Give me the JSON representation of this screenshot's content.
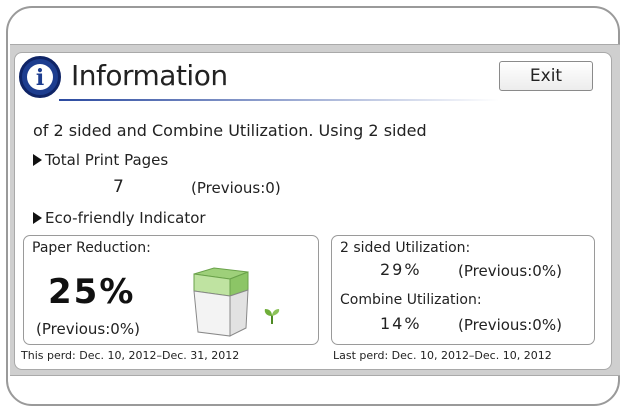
{
  "header": {
    "title": "Information",
    "exit_label": "Exit"
  },
  "description": "of 2 sided and Combine Utilization. Using 2 sided",
  "total_print_pages": {
    "heading": "Total Print Pages",
    "value": "7",
    "previous": "(Previous:0)"
  },
  "eco": {
    "heading": "Eco-friendly Indicator",
    "paper_reduction": {
      "label": "Paper Reduction:",
      "value": "25%",
      "previous": "(Previous:0%)"
    },
    "two_sided": {
      "label": "2 sided Utilization:",
      "value": "29%",
      "previous": "(Previous:0%)"
    },
    "combine": {
      "label": "Combine Utilization:",
      "value": "14%",
      "previous": "(Previous:0%)"
    }
  },
  "footer": {
    "this_period": "This perd: Dec. 10, 2012–Dec. 31, 2012",
    "last_period": "Last perd: Dec. 10, 2012–Dec. 10, 2012"
  },
  "icons": {
    "info": "info-icon",
    "bin": "paper-bin-icon",
    "sprout": "sprout-icon",
    "bullet": "triangle-bullet-icon"
  },
  "colors": {
    "accent": "#1d3d8f",
    "bin_green": "#7fbf5a",
    "sprout_green": "#5a9a2a"
  }
}
